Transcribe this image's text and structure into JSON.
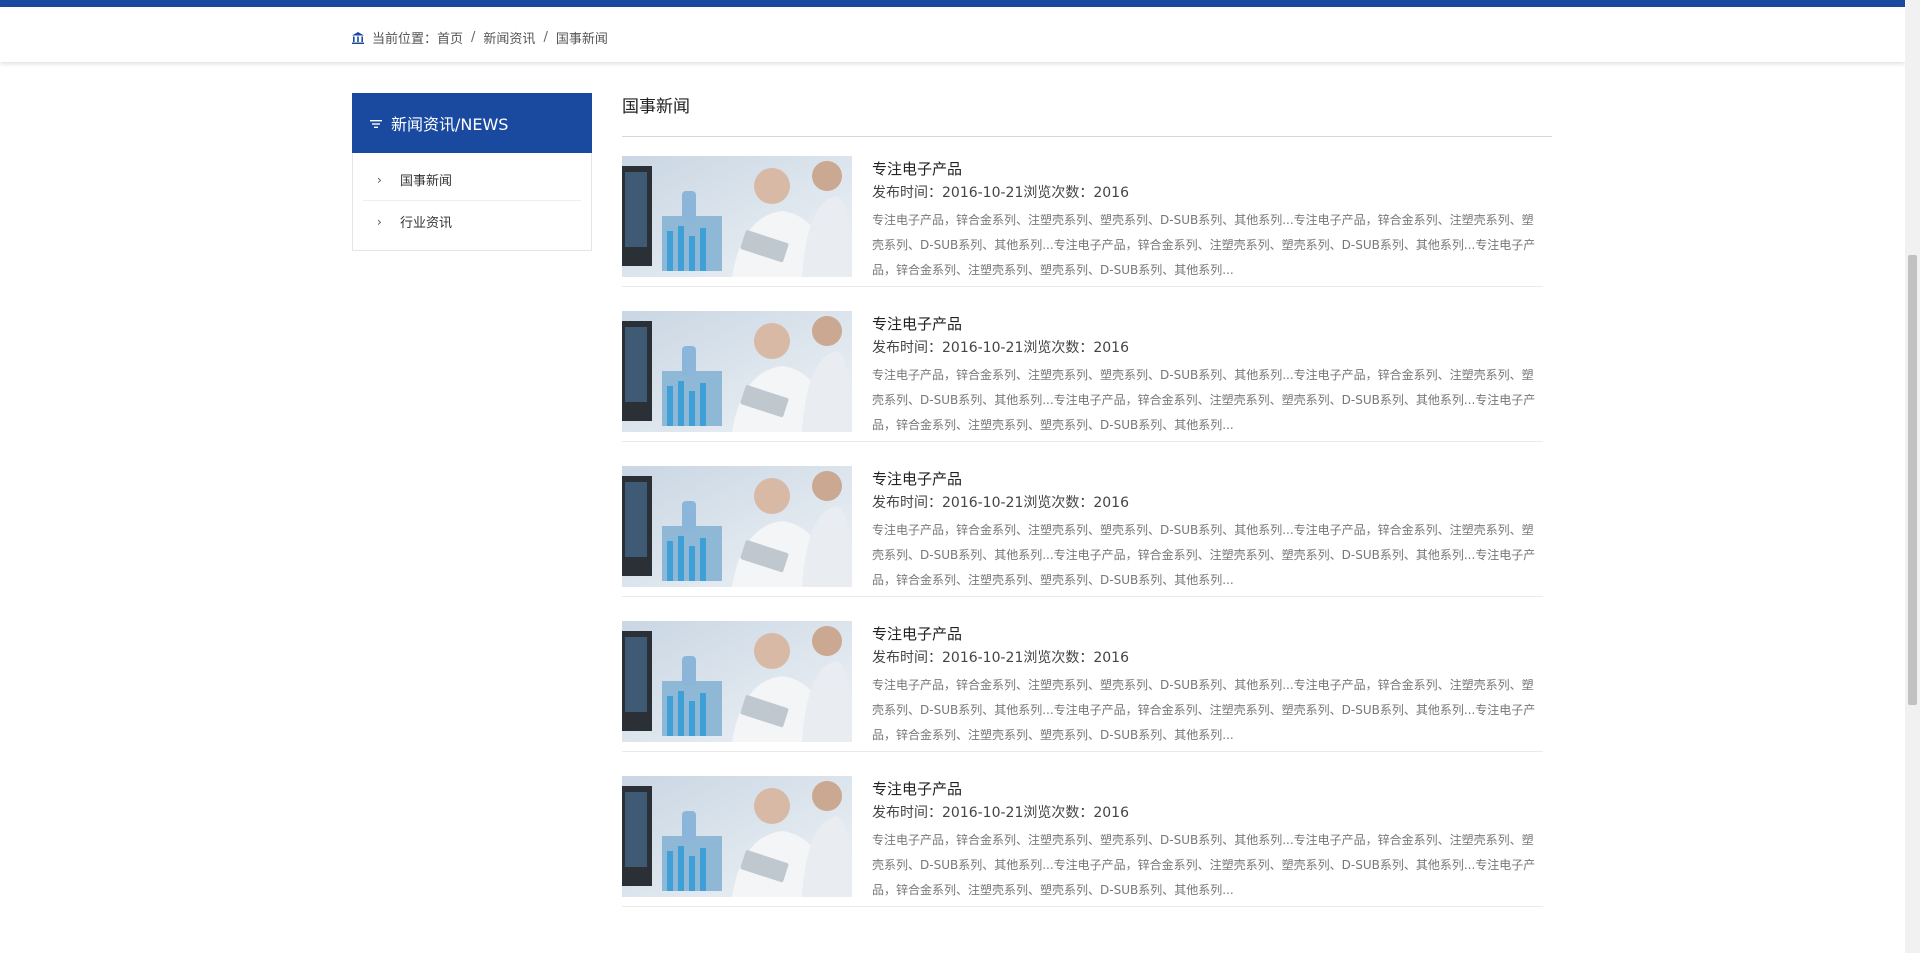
{
  "colors": {
    "brand": "#1a4aa0"
  },
  "breadcrumb": {
    "prefix": "当前位置：",
    "items": [
      "首页",
      "新闻资讯",
      "国事新闻"
    ],
    "icon": "home-icon"
  },
  "sidebar": {
    "header": "新闻资讯/NEWS",
    "header_icon": "filter-icon",
    "items": [
      {
        "label": "国事新闻"
      },
      {
        "label": "行业资讯"
      }
    ]
  },
  "main": {
    "section_title": "国事新闻",
    "news": [
      {
        "title": "专注电子产品",
        "meta": "发布时间：2016-10-21浏览次数：2016",
        "summary": "专注电子产品，锌合金系列、注塑壳系列、塑壳系列、D-SUB系列、其他系列...专注电子产品，锌合金系列、注塑壳系列、塑壳系列、D-SUB系列、其他系列...专注电子产品，锌合金系列、注塑壳系列、塑壳系列、D-SUB系列、其他系列...专注电子产品，锌合金系列、注塑壳系列、塑壳系列、D-SUB系列、其他系列..."
      },
      {
        "title": "专注电子产品",
        "meta": "发布时间：2016-10-21浏览次数：2016",
        "summary": "专注电子产品，锌合金系列、注塑壳系列、塑壳系列、D-SUB系列、其他系列...专注电子产品，锌合金系列、注塑壳系列、塑壳系列、D-SUB系列、其他系列...专注电子产品，锌合金系列、注塑壳系列、塑壳系列、D-SUB系列、其他系列...专注电子产品，锌合金系列、注塑壳系列、塑壳系列、D-SUB系列、其他系列..."
      },
      {
        "title": "专注电子产品",
        "meta": "发布时间：2016-10-21浏览次数：2016",
        "summary": "专注电子产品，锌合金系列、注塑壳系列、塑壳系列、D-SUB系列、其他系列...专注电子产品，锌合金系列、注塑壳系列、塑壳系列、D-SUB系列、其他系列...专注电子产品，锌合金系列、注塑壳系列、塑壳系列、D-SUB系列、其他系列...专注电子产品，锌合金系列、注塑壳系列、塑壳系列、D-SUB系列、其他系列..."
      },
      {
        "title": "专注电子产品",
        "meta": "发布时间：2016-10-21浏览次数：2016",
        "summary": "专注电子产品，锌合金系列、注塑壳系列、塑壳系列、D-SUB系列、其他系列...专注电子产品，锌合金系列、注塑壳系列、塑壳系列、D-SUB系列、其他系列...专注电子产品，锌合金系列、注塑壳系列、塑壳系列、D-SUB系列、其他系列...专注电子产品，锌合金系列、注塑壳系列、塑壳系列、D-SUB系列、其他系列..."
      },
      {
        "title": "专注电子产品",
        "meta": "发布时间：2016-10-21浏览次数：2016",
        "summary": "专注电子产品，锌合金系列、注塑壳系列、塑壳系列、D-SUB系列、其他系列...专注电子产品，锌合金系列、注塑壳系列、塑壳系列、D-SUB系列、其他系列...专注电子产品，锌合金系列、注塑壳系列、塑壳系列、D-SUB系列、其他系列...专注电子产品，锌合金系列、注塑壳系列、塑壳系列、D-SUB系列、其他系列..."
      }
    ]
  }
}
